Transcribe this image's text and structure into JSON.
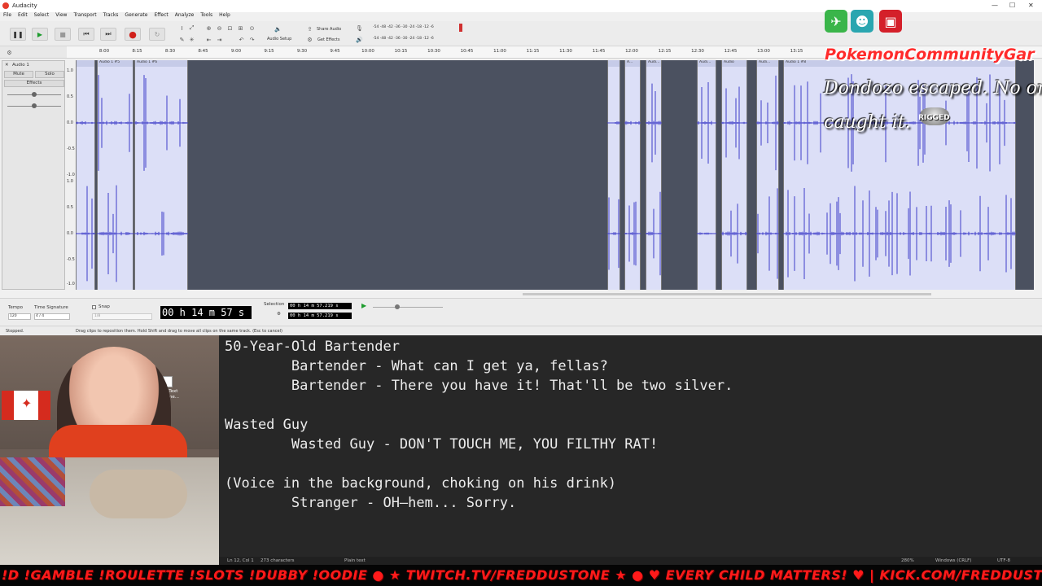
{
  "window": {
    "title": "Audacity",
    "min": "—",
    "max": "☐",
    "close": "✕"
  },
  "menu": [
    "File",
    "Edit",
    "Select",
    "View",
    "Transport",
    "Tracks",
    "Generate",
    "Effect",
    "Analyze",
    "Tools",
    "Help"
  ],
  "toolbar": {
    "share_audio": "Share Audio",
    "get_effects": "Get Effects",
    "audio_setup": "Audio Setup",
    "meter_scale": "-54 -48 -42 -36 -30 -24 -18 -12 -6"
  },
  "ruler": [
    "8:00",
    "8:15",
    "8:30",
    "8:45",
    "9:00",
    "9:15",
    "9:30",
    "9:45",
    "10:00",
    "10:15",
    "10:30",
    "10:45",
    "11:00",
    "11:15",
    "11:30",
    "11:45",
    "12:00",
    "12:15",
    "12:30",
    "12:45",
    "13:00",
    "13:15"
  ],
  "track": {
    "name": "Audio 1",
    "mute": "Mute",
    "solo": "Solo",
    "effects": "Effects",
    "scale_top": [
      "1.0",
      "0.5",
      "0.0",
      "-0.5",
      "-1.0"
    ],
    "scale_bottom": [
      "1.0",
      "0.5",
      "0.0",
      "-0.5",
      "-1.0"
    ]
  },
  "clips": {
    "c1": "Audio 1 #5",
    "c2": "Audio 1 #6",
    "c3": "Audio 1 #8",
    "c4": "A...",
    "c5": "Audi...",
    "c6": "Audi...",
    "c7": "Audio",
    "c8": "Audi...",
    "c9": "Audio 1 #8"
  },
  "selection_bar": {
    "tempo_label": "Tempo",
    "tempo_value": "120",
    "timesig_label": "Time Signature",
    "timesig_value": "4 / 4",
    "snap_label": "Snap",
    "snap_value": "1/8",
    "time_display": "00 h 14 m 57 s",
    "selection_label": "Selection",
    "sel_start": "00 h 14 m 57.219 s",
    "sel_end": "00 h 14 m 57.219 s"
  },
  "status": {
    "left": "Stopped.",
    "message": "Drag clips to reposition them. Hold Shift and drag to move all clips on the same track. (Esc to cancel)"
  },
  "editor": {
    "lines": [
      "50-Year-Old Bartender",
      "        Bartender - What can I get ya, fellas?",
      "        Bartender - There you have it! That'll be two silver.",
      "",
      "Wasted Guy",
      "        Wasted Guy - DON'T TOUCH ME, YOU FILTHY RAT!",
      "",
      "(Voice in the background, choking on his drink)",
      "        Stranger - OH—hem... Sorry."
    ],
    "status_pos": "Ln 12, Col 1",
    "status_chars": "273 characters",
    "status_type": "Plain text",
    "status_zoom": "280%",
    "status_eol": "Windows (CRLF)",
    "status_enc": "UTF-8"
  },
  "desktop_icon": "New Text Docume...",
  "overlay": {
    "channel": "PokemonCommunityGar",
    "chat_line1": "Dondozo escaped. No on",
    "chat_line2": "caught it.",
    "rigged": "RIGGED"
  },
  "ticker": "!D !GAMBLE !ROULETTE !SLOTS !DUBBY !OODIE  ●  ★ TWITCH.TV/FREDDUSTONE ★  ●  ♥ EVERY CHILD MATTERS! ♥  |  KICK.COM/FREDDUSTONE",
  "colors": {
    "waveform": "#3e3ec8",
    "clip_bg": "#dcdff7",
    "track_bg": "#4b5160",
    "ticker": "#ff1a1a",
    "editor_bg": "#272727"
  }
}
